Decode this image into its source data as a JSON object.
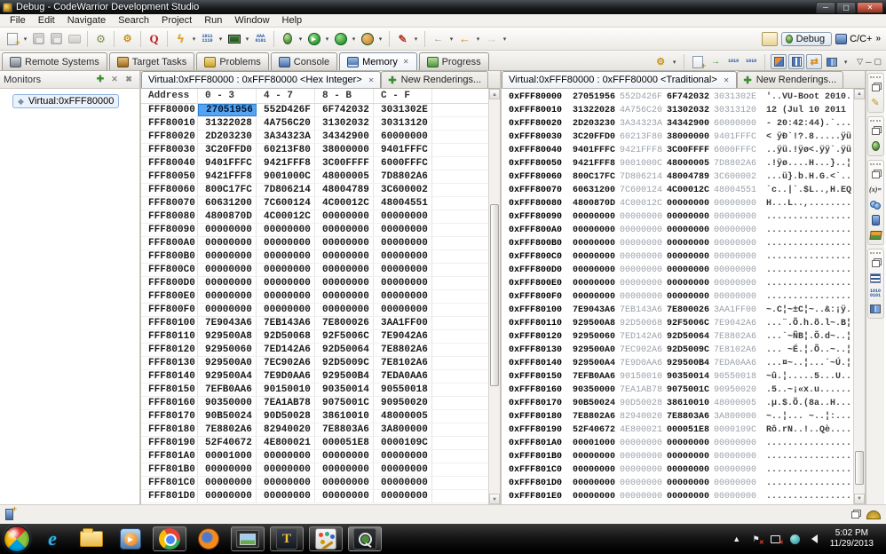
{
  "window": {
    "title": "Debug - CodeWarrior Development Studio"
  },
  "menu": [
    "File",
    "Edit",
    "Navigate",
    "Search",
    "Project",
    "Run",
    "Window",
    "Help"
  ],
  "perspectives": {
    "debug": "Debug",
    "cpp": "C/C+",
    "overflow": "»"
  },
  "view_tabs": [
    "Remote Systems",
    "Target Tasks",
    "Problems",
    "Console",
    "Memory",
    "Progress"
  ],
  "monitors_panel": {
    "title": "Monitors",
    "item": "Virtual:0xFFF80000"
  },
  "hex_view": {
    "tab": "Virtual:0xFFF80000 : 0xFFF80000 <Hex Integer>",
    "new_tab": "New Renderings...",
    "columns": [
      "Address",
      "0 - 3",
      "4 - 7",
      "8 - B",
      "C - F"
    ],
    "selected": {
      "row": 0,
      "col": 0
    },
    "rows": [
      {
        "addr": "FFF80000",
        "v": [
          "27051956",
          "552D426F",
          "6F742032",
          "3031302E"
        ]
      },
      {
        "addr": "FFF80010",
        "v": [
          "31322028",
          "4A756C20",
          "31302032",
          "30313120"
        ]
      },
      {
        "addr": "FFF80020",
        "v": [
          "2D203230",
          "3A34323A",
          "34342900",
          "60000000"
        ]
      },
      {
        "addr": "FFF80030",
        "v": [
          "3C20FFD0",
          "60213F80",
          "38000000",
          "9401FFFC"
        ]
      },
      {
        "addr": "FFF80040",
        "v": [
          "9401FFFC",
          "9421FFF8",
          "3C00FFFF",
          "6000FFFC"
        ]
      },
      {
        "addr": "FFF80050",
        "v": [
          "9421FFF8",
          "9001000C",
          "48000005",
          "7D8802A6"
        ]
      },
      {
        "addr": "FFF80060",
        "v": [
          "800C17FC",
          "7D806214",
          "48004789",
          "3C600002"
        ]
      },
      {
        "addr": "FFF80070",
        "v": [
          "60631200",
          "7C600124",
          "4C00012C",
          "48004551"
        ]
      },
      {
        "addr": "FFF80080",
        "v": [
          "4800870D",
          "4C00012C",
          "00000000",
          "00000000"
        ]
      },
      {
        "addr": "FFF80090",
        "v": [
          "00000000",
          "00000000",
          "00000000",
          "00000000"
        ]
      },
      {
        "addr": "FFF800A0",
        "v": [
          "00000000",
          "00000000",
          "00000000",
          "00000000"
        ]
      },
      {
        "addr": "FFF800B0",
        "v": [
          "00000000",
          "00000000",
          "00000000",
          "00000000"
        ]
      },
      {
        "addr": "FFF800C0",
        "v": [
          "00000000",
          "00000000",
          "00000000",
          "00000000"
        ]
      },
      {
        "addr": "FFF800D0",
        "v": [
          "00000000",
          "00000000",
          "00000000",
          "00000000"
        ]
      },
      {
        "addr": "FFF800E0",
        "v": [
          "00000000",
          "00000000",
          "00000000",
          "00000000"
        ]
      },
      {
        "addr": "FFF800F0",
        "v": [
          "00000000",
          "00000000",
          "00000000",
          "00000000"
        ]
      },
      {
        "addr": "FFF80100",
        "v": [
          "7E9043A6",
          "7EB143A6",
          "7E800026",
          "3AA1FF00"
        ]
      },
      {
        "addr": "FFF80110",
        "v": [
          "929500A8",
          "92D50068",
          "92F5006C",
          "7E9042A6"
        ]
      },
      {
        "addr": "FFF80120",
        "v": [
          "92950060",
          "7ED142A6",
          "92D50064",
          "7E8802A6"
        ]
      },
      {
        "addr": "FFF80130",
        "v": [
          "929500A0",
          "7EC902A6",
          "92D5009C",
          "7E8102A6"
        ]
      },
      {
        "addr": "FFF80140",
        "v": [
          "929500A4",
          "7E9D0AA6",
          "929500B4",
          "7EDA0AA6"
        ]
      },
      {
        "addr": "FFF80150",
        "v": [
          "7EFB0AA6",
          "90150010",
          "90350014",
          "90550018"
        ]
      },
      {
        "addr": "FFF80160",
        "v": [
          "90350000",
          "7EA1AB78",
          "9075001C",
          "90950020"
        ]
      },
      {
        "addr": "FFF80170",
        "v": [
          "90B50024",
          "90D50028",
          "38610010",
          "48000005"
        ]
      },
      {
        "addr": "FFF80180",
        "v": [
          "7E8802A6",
          "82940020",
          "7E8803A6",
          "3A800000"
        ]
      },
      {
        "addr": "FFF80190",
        "v": [
          "52F40672",
          "4E800021",
          "000051E8",
          "0000109C"
        ]
      },
      {
        "addr": "FFF801A0",
        "v": [
          "00001000",
          "00000000",
          "00000000",
          "00000000"
        ]
      },
      {
        "addr": "FFF801B0",
        "v": [
          "00000000",
          "00000000",
          "00000000",
          "00000000"
        ]
      },
      {
        "addr": "FFF801C0",
        "v": [
          "00000000",
          "00000000",
          "00000000",
          "00000000"
        ]
      },
      {
        "addr": "FFF801D0",
        "v": [
          "00000000",
          "00000000",
          "00000000",
          "00000000"
        ]
      }
    ]
  },
  "traditional_view": {
    "tab": "Virtual:0xFFF80000 : 0xFFF80000 <Traditional>",
    "new_tab": "New Renderings...",
    "rows": [
      {
        "addr": "0xFFF80000",
        "v": [
          "27051956",
          "552D426F",
          "6F742032",
          "3031302E"
        ],
        "ascii": "'..VU-Boot 2010."
      },
      {
        "addr": "0xFFF80010",
        "v": [
          "31322028",
          "4A756C20",
          "31302032",
          "30313120"
        ],
        "ascii": "12 (Jul 10 2011 "
      },
      {
        "addr": "0xFFF80020",
        "v": [
          "2D203230",
          "3A34323A",
          "34342900",
          "60000000"
        ],
        "ascii": "- 20:42:44).`..."
      },
      {
        "addr": "0xFFF80030",
        "v": [
          "3C20FFD0",
          "60213F80",
          "38000000",
          "9401FFFC"
        ],
        "ascii": "< ÿÐ`!?.8.....ÿü"
      },
      {
        "addr": "0xFFF80040",
        "v": [
          "9401FFFC",
          "9421FFF8",
          "3C00FFFF",
          "6000FFFC"
        ],
        "ascii": "..ÿü.!ÿø<.ÿÿ`.ÿü"
      },
      {
        "addr": "0xFFF80050",
        "v": [
          "9421FFF8",
          "9001000C",
          "48000005",
          "7D8802A6"
        ],
        "ascii": ".!ÿø....H...}..¦"
      },
      {
        "addr": "0xFFF80060",
        "v": [
          "800C17FC",
          "7D806214",
          "48004789",
          "3C600002"
        ],
        "ascii": "...ü}.b.H.G.<`.."
      },
      {
        "addr": "0xFFF80070",
        "v": [
          "60631200",
          "7C600124",
          "4C00012C",
          "48004551"
        ],
        "ascii": "`c..|`.$L..,H.EQ"
      },
      {
        "addr": "0xFFF80080",
        "v": [
          "4800870D",
          "4C00012C",
          "00000000",
          "00000000"
        ],
        "ascii": "H...L..,........"
      },
      {
        "addr": "0xFFF80090",
        "v": [
          "00000000",
          "00000000",
          "00000000",
          "00000000"
        ],
        "ascii": "................"
      },
      {
        "addr": "0xFFF800A0",
        "v": [
          "00000000",
          "00000000",
          "00000000",
          "00000000"
        ],
        "ascii": "................"
      },
      {
        "addr": "0xFFF800B0",
        "v": [
          "00000000",
          "00000000",
          "00000000",
          "00000000"
        ],
        "ascii": "................"
      },
      {
        "addr": "0xFFF800C0",
        "v": [
          "00000000",
          "00000000",
          "00000000",
          "00000000"
        ],
        "ascii": "................"
      },
      {
        "addr": "0xFFF800D0",
        "v": [
          "00000000",
          "00000000",
          "00000000",
          "00000000"
        ],
        "ascii": "................"
      },
      {
        "addr": "0xFFF800E0",
        "v": [
          "00000000",
          "00000000",
          "00000000",
          "00000000"
        ],
        "ascii": "................"
      },
      {
        "addr": "0xFFF800F0",
        "v": [
          "00000000",
          "00000000",
          "00000000",
          "00000000"
        ],
        "ascii": "................"
      },
      {
        "addr": "0xFFF80100",
        "v": [
          "7E9043A6",
          "7EB143A6",
          "7E800026",
          "3AA1FF00"
        ],
        "ascii": "~.C¦~±C¦~..&:¡ÿ."
      },
      {
        "addr": "0xFFF80110",
        "v": [
          "929500A8",
          "92D50068",
          "92F5006C",
          "7E9042A6"
        ],
        "ascii": "...¨.Õ.h.õ.l~.B¦"
      },
      {
        "addr": "0xFFF80120",
        "v": [
          "92950060",
          "7ED142A6",
          "92D50064",
          "7E8802A6"
        ],
        "ascii": "...`~ÑB¦.Õ.d~..¦"
      },
      {
        "addr": "0xFFF80130",
        "v": [
          "929500A0",
          "7EC902A6",
          "92D5009C",
          "7E8102A6"
        ],
        "ascii": "... ~É.¦.Õ..~..¦"
      },
      {
        "addr": "0xFFF80140",
        "v": [
          "929500A4",
          "7E9D0AA6",
          "929500B4",
          "7EDA0AA6"
        ],
        "ascii": "...¤~..¦...´~Ú.¦"
      },
      {
        "addr": "0xFFF80150",
        "v": [
          "7EFB0AA6",
          "90150010",
          "90350014",
          "90550018"
        ],
        "ascii": "~û.¦.....5...U.."
      },
      {
        "addr": "0xFFF80160",
        "v": [
          "90350000",
          "7EA1AB78",
          "9075001C",
          "90950020"
        ],
        "ascii": ".5..~¡«x.u......"
      },
      {
        "addr": "0xFFF80170",
        "v": [
          "90B50024",
          "90D50028",
          "38610010",
          "48000005"
        ],
        "ascii": ".µ.$.Õ.(8a..H..."
      },
      {
        "addr": "0xFFF80180",
        "v": [
          "7E8802A6",
          "82940020",
          "7E8803A6",
          "3A800000"
        ],
        "ascii": "~..¦... ~..¦:..."
      },
      {
        "addr": "0xFFF80190",
        "v": [
          "52F40672",
          "4E800021",
          "000051E8",
          "0000109C"
        ],
        "ascii": "Rô.rN..!..Qè...."
      },
      {
        "addr": "0xFFF801A0",
        "v": [
          "00001000",
          "00000000",
          "00000000",
          "00000000"
        ],
        "ascii": "................"
      },
      {
        "addr": "0xFFF801B0",
        "v": [
          "00000000",
          "00000000",
          "00000000",
          "00000000"
        ],
        "ascii": "................"
      },
      {
        "addr": "0xFFF801C0",
        "v": [
          "00000000",
          "00000000",
          "00000000",
          "00000000"
        ],
        "ascii": "................"
      },
      {
        "addr": "0xFFF801D0",
        "v": [
          "00000000",
          "00000000",
          "00000000",
          "00000000"
        ],
        "ascii": "................"
      },
      {
        "addr": "0xFFF801E0",
        "v": [
          "00000000",
          "00000000",
          "00000000",
          "00000000"
        ],
        "ascii": "................"
      }
    ]
  },
  "taskbar": {
    "clock_time": "5:02 PM",
    "clock_date": "11/29/2013"
  },
  "icons": {
    "close": "✕",
    "dropdown": "▾",
    "add": "✚",
    "remove": "✕",
    "remove_all": "✖",
    "up_arrow": "▲",
    "down_arrow": "▼",
    "back": "←",
    "forward": "→",
    "play": "▶",
    "pencil": "✎",
    "overflow": "»",
    "minimize": "─",
    "maximize": "▢",
    "menu_chevron": "▽",
    "gears": "⚙",
    "bolt": "ϟ",
    "q_letter": "Q",
    "rocket": "✎",
    "ones_zeros": "1011\n1110",
    "ones_zeros2": "1010\n0101",
    "vars": "(x)=",
    "flag": "⚑",
    "tray_up": "▲"
  }
}
